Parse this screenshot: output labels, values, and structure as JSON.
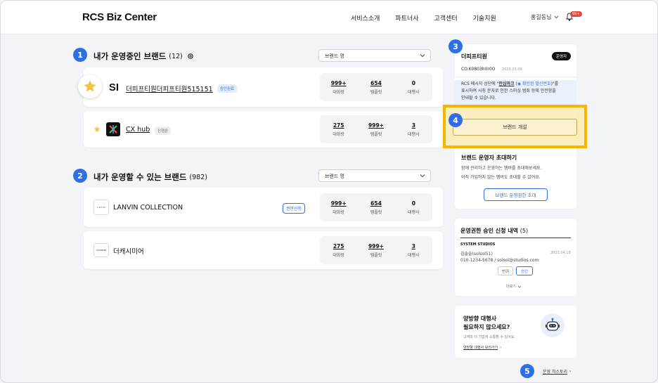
{
  "header": {
    "logo": "RCS Biz Center",
    "nav": [
      "서비스소개",
      "파트너사",
      "고객센터",
      "기술지원"
    ],
    "user": "홍길동님",
    "notification_badge": "99+"
  },
  "steps": [
    "1",
    "2",
    "3",
    "4",
    "5"
  ],
  "section1": {
    "title": "내가 운영중인 브랜드",
    "count": "(12)",
    "select_label": "브랜드 명",
    "brands": [
      {
        "logo": "SI",
        "name": "더피프티원더피프티원515151",
        "badge": "승인완료",
        "stats": [
          {
            "value": "999+",
            "label": "대화방"
          },
          {
            "value": "654",
            "label": "템플릿"
          },
          {
            "value": "0",
            "label": "대행사"
          }
        ]
      },
      {
        "name": "CX hub",
        "badge": "진행중",
        "stats": [
          {
            "value": "275",
            "label": "대화방"
          },
          {
            "value": "999+",
            "label": "템플릿"
          },
          {
            "value": "3",
            "label": "대행사"
          }
        ]
      }
    ]
  },
  "section2": {
    "title": "내가 운영할 수 있는 브랜드",
    "count": "(982)",
    "select_label": "브랜드 명",
    "brands": [
      {
        "logo_text": "LANVIN",
        "name": "LANVIN COLLECTION",
        "action": "권한신청",
        "stats": [
          {
            "value": "999+",
            "label": "대화방"
          },
          {
            "value": "654",
            "label": "템플릿"
          },
          {
            "value": "0",
            "label": "대행사"
          }
        ]
      },
      {
        "logo_text": "CASHMERE",
        "name": "더캐시미어",
        "stats": [
          {
            "value": "275",
            "label": "대화방"
          },
          {
            "value": "999+",
            "label": "템플릿"
          },
          {
            "value": "3",
            "label": "대행사"
          }
        ]
      }
    ]
  },
  "right": {
    "brand_card": {
      "name": "더피프티원",
      "role": "운영자",
      "code": "CO.K0803h0r0O",
      "date": "2023.03.09",
      "notice_line1_prefix": "RCS 메시지 상단에 \"",
      "notice_mark": "안심마크",
      "notice_verified": "확인된 발신번호",
      "notice_line1_suffix": "\"를",
      "notice_line2": "표시하여 사칭 문자로 인한 스미싱 범죄 등에 안전함을",
      "notice_line3": "안내할 수 있습니다.",
      "open_button": "브랜드 개설"
    },
    "invite": {
      "title": "브랜드 운영자 초대하기",
      "desc1": "함께 관리하고 운영하는 멤버를 초대해보세요.",
      "desc2": "아직 가입하지 않는 멤버도 초대할 수 있어요.",
      "button": "브랜드 운영권한 초대"
    },
    "approval": {
      "title": "운영권한 승인 신청 내역",
      "count": "(5)",
      "company": "SYSTEM STUDIOS",
      "person": "김솔솔(solsol51)",
      "date": "2023.04.18",
      "contact": "010-1234-5678 / solsol@studios.com",
      "reject": "반려",
      "approve": "승인",
      "more": "더보기"
    },
    "agency": {
      "title1": "양방향 대행사",
      "title2": "필요하지 않으세요?",
      "desc": "고객과 더 가깝게 소통할 수 있어요.",
      "link": "양방향 대행사 보러가기"
    },
    "history": "운영 히스토리"
  },
  "colors": {
    "accent": "#2f6fe4",
    "highlight": "#f7b500",
    "background": "#f3f4f7"
  }
}
